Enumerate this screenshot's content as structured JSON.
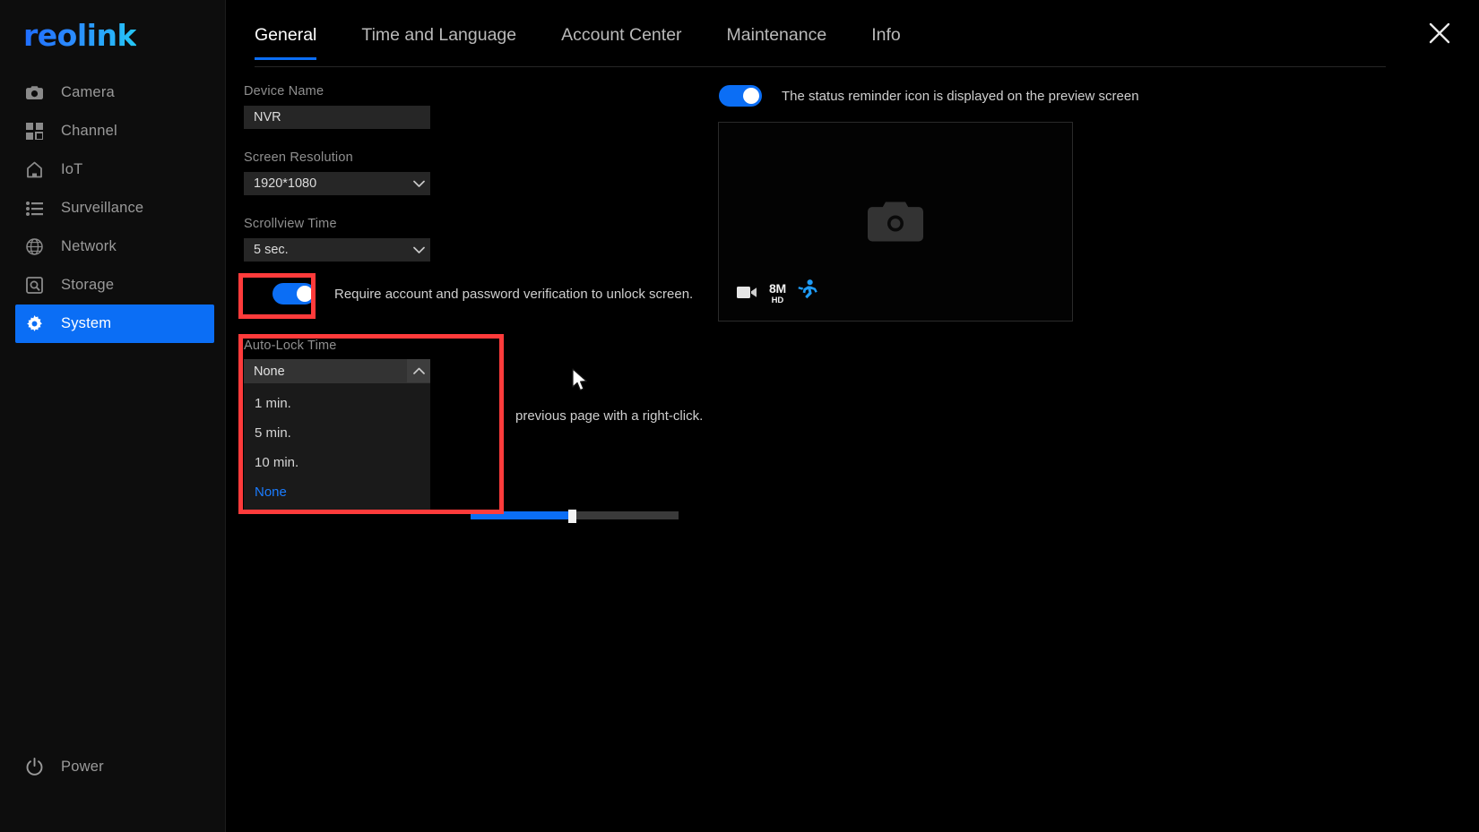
{
  "brand": {
    "logo_text": "reolink"
  },
  "sidebar": {
    "items": [
      {
        "label": "Camera",
        "icon": "camera-icon",
        "active": false
      },
      {
        "label": "Channel",
        "icon": "grid-icon",
        "active": false
      },
      {
        "label": "IoT",
        "icon": "home-icon",
        "active": false
      },
      {
        "label": "Surveillance",
        "icon": "list-icon",
        "active": false
      },
      {
        "label": "Network",
        "icon": "globe-icon",
        "active": false
      },
      {
        "label": "Storage",
        "icon": "disk-icon",
        "active": false
      },
      {
        "label": "System",
        "icon": "gear-icon",
        "active": true
      }
    ],
    "power": {
      "label": "Power",
      "icon": "power-icon"
    }
  },
  "tabs": [
    {
      "label": "General",
      "active": true
    },
    {
      "label": "Time and Language",
      "active": false
    },
    {
      "label": "Account Center",
      "active": false
    },
    {
      "label": "Maintenance",
      "active": false
    },
    {
      "label": "Info",
      "active": false
    }
  ],
  "close_button": {
    "icon": "close-icon",
    "label": "✕"
  },
  "form": {
    "device_name": {
      "label": "Device Name",
      "value": "NVR",
      "placeholder": "NVR"
    },
    "screen_resolution": {
      "label": "Screen Resolution",
      "value": "1920*1080"
    },
    "scrollview_time": {
      "label": "Scrollview Time",
      "value": "5 sec."
    },
    "unlock_verification": {
      "label": "Require account and password verification to unlock screen.",
      "enabled": true
    },
    "auto_lock_time": {
      "label": "Auto-Lock Time",
      "value": "None",
      "expanded": true,
      "options": [
        "1 min.",
        "5 min.",
        "10 min.",
        "None"
      ],
      "selected": "None"
    },
    "hint_text": "previous page with a right-click.",
    "slider": {
      "value_percent": 49
    }
  },
  "right_panel": {
    "status_reminder": {
      "label": "The status reminder icon is displayed on the preview screen",
      "enabled": true
    },
    "preview": {
      "placeholder_icon": "camera-placeholder-icon",
      "badges": [
        {
          "type": "icon",
          "name": "video-camera-icon"
        },
        {
          "type": "text",
          "big": "8M",
          "small": "HD"
        },
        {
          "type": "icon",
          "name": "person-running-icon"
        }
      ]
    }
  },
  "annotations": {
    "highlight_color": "#ff3b3b",
    "boxes": [
      {
        "name": "toggle-highlight"
      },
      {
        "name": "autolock-highlight"
      }
    ]
  },
  "colors": {
    "accent": "#0b6ef5",
    "background": "#000000",
    "sidebar_bg": "#0d0d0d",
    "input_bg": "#262626",
    "highlight_red": "#ff3b3b",
    "selected_blue": "#1a7cff"
  }
}
